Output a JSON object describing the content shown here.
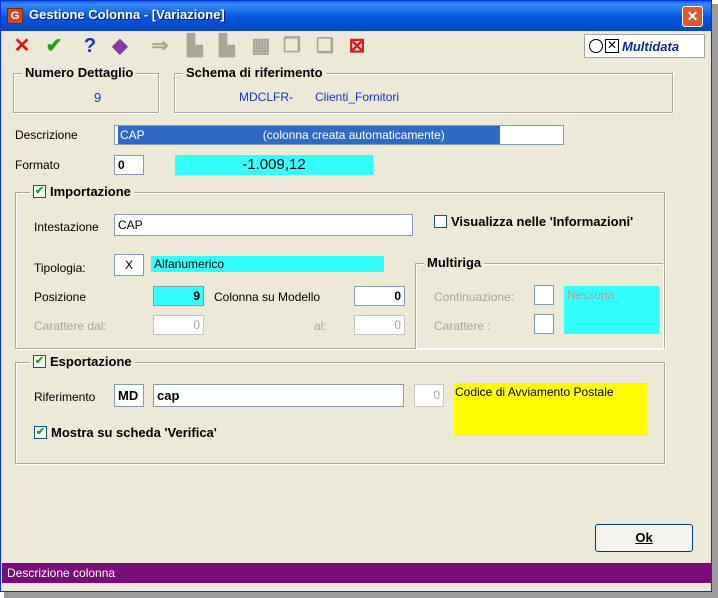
{
  "window": {
    "title": "Gestione Colonna - [Variazione]",
    "close_glyph": "✕"
  },
  "toolbar": {
    "buttons": [
      {
        "name": "cancel-icon",
        "glyph": "✕",
        "color": "#d81c1c"
      },
      {
        "name": "confirm-icon",
        "glyph": "✔",
        "color": "#21a121"
      },
      {
        "name": "help-icon",
        "glyph": "?",
        "color": "#1535c8"
      },
      {
        "name": "tag-icon",
        "glyph": "◆",
        "color": "#8a3aa6"
      },
      {
        "name": "export-icon",
        "glyph": "⇒",
        "color": "#a8a69a"
      },
      {
        "name": "binoculars-icon",
        "glyph": "▙",
        "color": "#a8a69a"
      },
      {
        "name": "binoculars-next-icon",
        "glyph": "▙",
        "color": "#a8a69a"
      },
      {
        "name": "calculator-icon",
        "glyph": "▦",
        "color": "#a8a69a"
      },
      {
        "name": "copy-icon",
        "glyph": "❐",
        "color": "#a8a69a"
      },
      {
        "name": "paste-icon",
        "glyph": "❏",
        "color": "#a8a69a"
      },
      {
        "name": "excel-disabled-icon",
        "glyph": "⊠",
        "color": "#d81c1c"
      }
    ],
    "logo_text": "Multidata"
  },
  "numero_dettaglio": {
    "label": "Numero Dettaglio",
    "value": "9"
  },
  "schema": {
    "label": "Schema di riferimento",
    "code": "MDCLFR-",
    "name": "Clienti_Fornitori"
  },
  "descrizione": {
    "label": "Descrizione",
    "value": "CAP",
    "note": "(colonna creata automaticamente)"
  },
  "formato": {
    "label": "Formato",
    "value": "0",
    "preview": "-1.009,12"
  },
  "importazione": {
    "label": "Importazione",
    "intestazione_label": "Intestazione",
    "intestazione_value": "CAP",
    "visualizza_label": "Visualizza nelle 'Informazioni'",
    "tipologia_label": "Tipologia:",
    "tipologia_code": "X",
    "tipologia_value": "Alfanumerico",
    "posizione_label": "Posizione",
    "posizione_value": "9",
    "colonna_label": "Colonna su Modello",
    "colonna_value": "0",
    "carattere_dal_label": "Carattere dal:",
    "carattere_dal_value": "0",
    "al_label": "al:",
    "al_value": "0"
  },
  "multiriga": {
    "label": "Multiriga",
    "continuazione_label": "Continuazione:",
    "carattere_label": "Carattere :",
    "value": "Nessuna"
  },
  "esportazione": {
    "label": "Esportazione",
    "riferimento_label": "Riferimento",
    "riferimento_code": "MD",
    "riferimento_value": "cap",
    "number_value": "0",
    "description": "Codice di Avviamento Postale",
    "mostra_label": "Mostra su scheda 'Verifica'"
  },
  "ok_label": "Ok",
  "status_text": "Descrizione colonna"
}
